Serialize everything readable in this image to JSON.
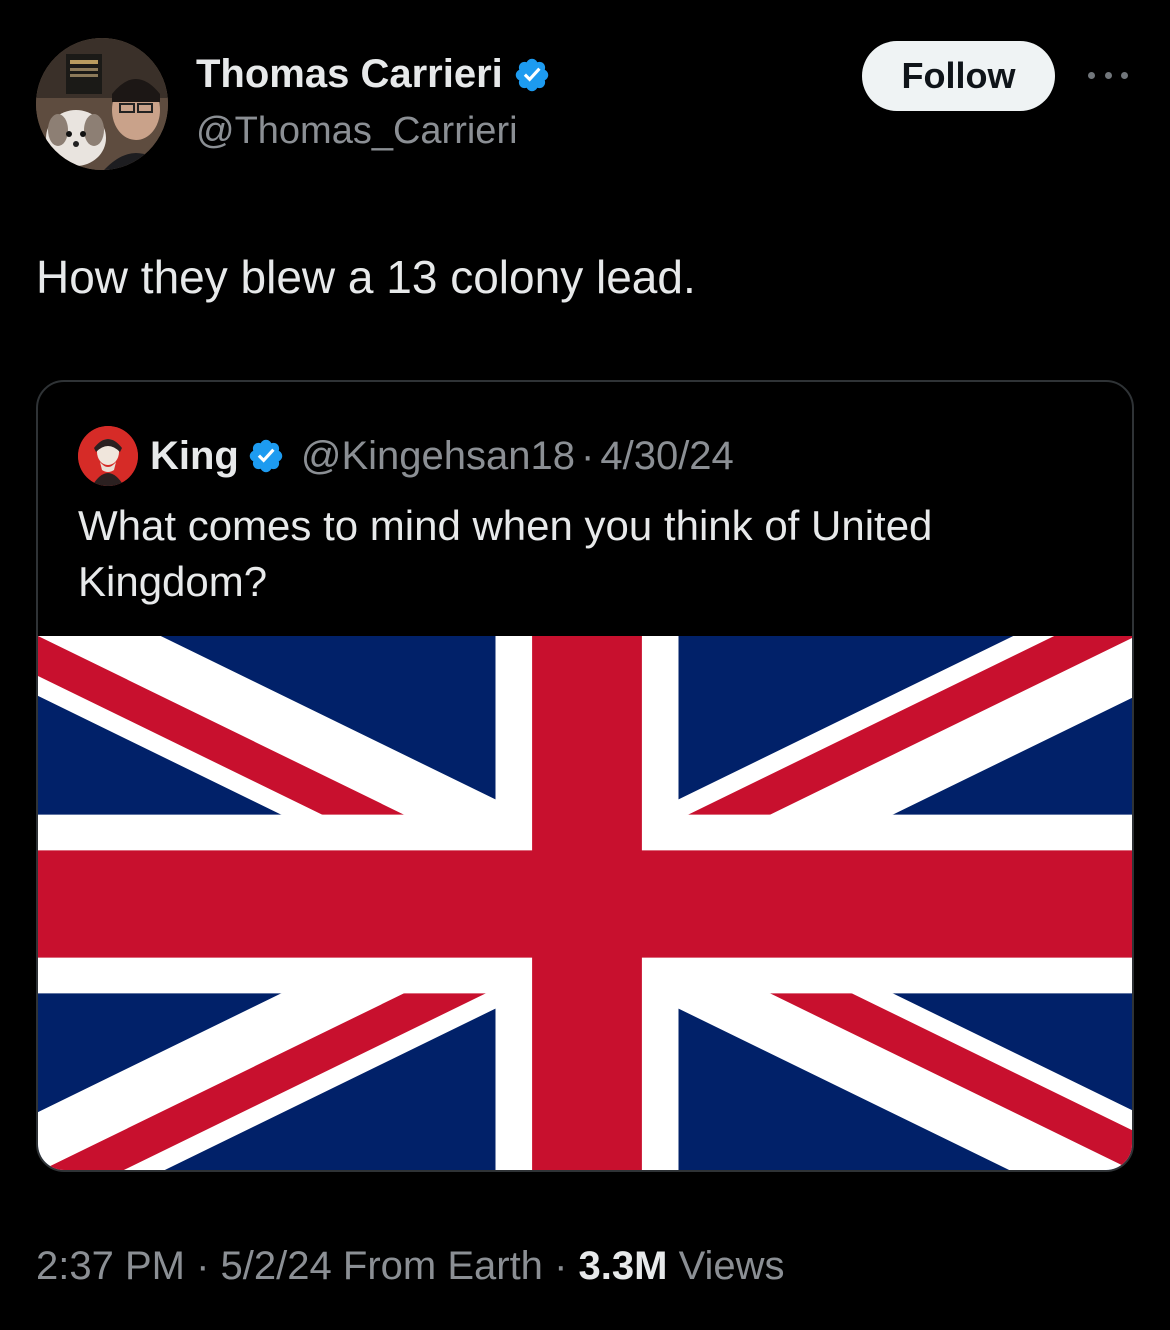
{
  "tweet": {
    "author": {
      "name": "Thomas Carrieri",
      "handle": "@Thomas_Carrieri",
      "verified": true,
      "avatar_icon": "profile-photo"
    },
    "follow_label": "Follow",
    "more_icon": "more-horizontal-icon",
    "text": "How they blew a 13 colony lead.",
    "quote": {
      "name": "King",
      "handle": "@Kingehsan18",
      "separator": "·",
      "date": "4/30/24",
      "verified": true,
      "text": "What comes to mind when you think of United Kingdom?",
      "media": "union-jack-flag-image"
    },
    "meta": {
      "time": "2:37 PM",
      "separator": "·",
      "date": "5/2/24",
      "location": "From Earth",
      "views_count": "3.3M",
      "views_label": "Views"
    }
  },
  "colors": {
    "background": "#000000",
    "text": "#e7e9ea",
    "muted": "#8b8f94",
    "verified": "#1d9bf0",
    "flag_blue": "#012169",
    "flag_red": "#c8102e",
    "flag_white": "#ffffff"
  }
}
